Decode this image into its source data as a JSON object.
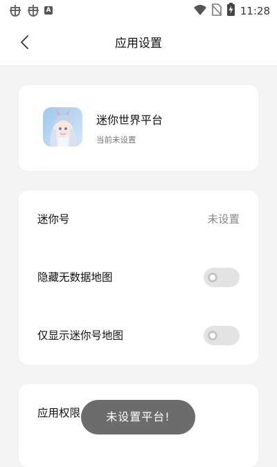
{
  "status_bar": {
    "time": "11:28",
    "left_icons": [
      "bug-icon",
      "bug-icon",
      "a-badge-icon"
    ],
    "right_icons": [
      "wifi-icon",
      "no-sim-icon",
      "battery-charging-icon"
    ],
    "a_badge": "A"
  },
  "header": {
    "title": "应用设置",
    "back_icon": "chevron-left-icon"
  },
  "platform_card": {
    "name": "迷你世界平台",
    "subtitle": "当前未设置"
  },
  "settings": {
    "mini_id_label": "迷你号",
    "mini_id_value": "未设置",
    "hide_empty_maps_label": "隐藏无数据地图",
    "hide_empty_maps_on": false,
    "show_mini_maps_label": "仅显示迷你号地图",
    "show_mini_maps_on": false
  },
  "permissions": {
    "label": "应用权限"
  },
  "toast": {
    "text": "未设置平台!"
  },
  "colors": {
    "background": "#f4f4f4",
    "card": "#ffffff",
    "toggle_off": "#e3e3e3",
    "toast_bg": "#646464"
  }
}
